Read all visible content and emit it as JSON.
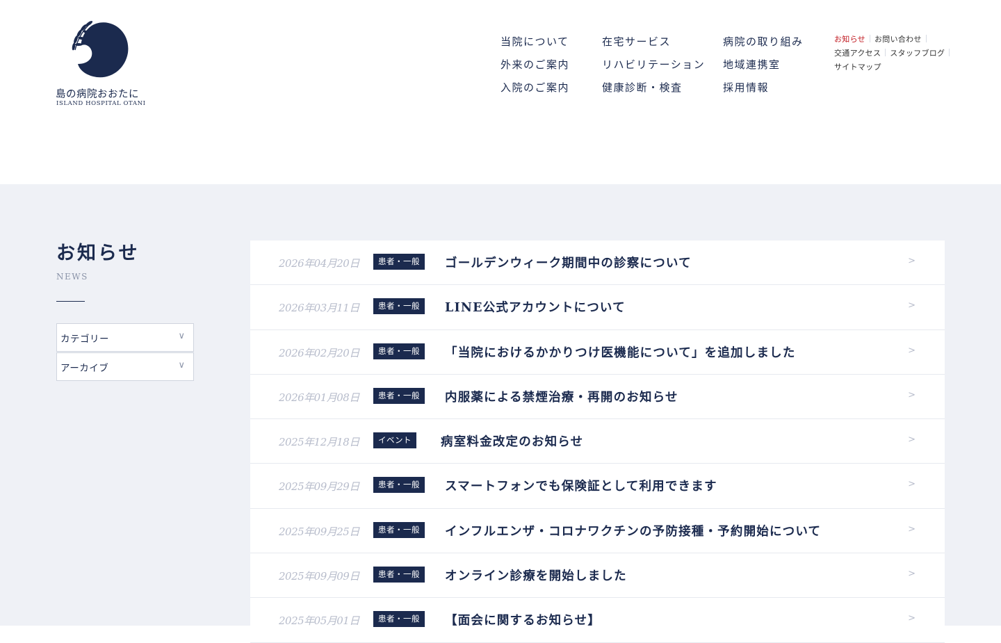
{
  "site": {
    "name_jp": "島の病院おおたに",
    "name_en": "ISLAND HOSPITAL OTANI"
  },
  "colors": {
    "navy": "#1b2a4e",
    "accent_red": "#c0171e",
    "page_bg": "#eff1f6"
  },
  "gnav": {
    "col1": [
      "当院について",
      "外来のご案内",
      "入院のご案内"
    ],
    "col2": [
      "在宅サービス",
      "リハビリテーション",
      "健康診断・検査"
    ],
    "col3": [
      "病院の取り組み",
      "地域連携室",
      "採用情報"
    ]
  },
  "subnav": {
    "news": "お知らせ",
    "contact": "お問い合わせ",
    "access": "交通アクセス",
    "blog": "スタッフブログ",
    "sitemap": "サイトマップ"
  },
  "side": {
    "title": "お知らせ",
    "subtitle": "NEWS",
    "category_label": "カテゴリー",
    "archive_label": "アーカイブ",
    "chevron": "∨"
  },
  "news": [
    {
      "date": "2026年04月20日",
      "tag": "患者・一般",
      "title": "ゴールデンウィーク期間中の診察について",
      "arrow": ">"
    },
    {
      "date": "2026年03月11日",
      "tag": "患者・一般",
      "title": "LINE公式アカウントについて",
      "arrow": ">"
    },
    {
      "date": "2026年02月20日",
      "tag": "患者・一般",
      "title": "「当院におけるかかりつけ医機能について」を追加しました",
      "arrow": ">"
    },
    {
      "date": "2026年01月08日",
      "tag": "患者・一般",
      "title": "内服薬による禁煙治療・再開のお知らせ",
      "arrow": ">"
    },
    {
      "date": "2025年12月18日",
      "tag": "イベント",
      "title": "病室料金改定のお知らせ",
      "arrow": ">"
    },
    {
      "date": "2025年09月29日",
      "tag": "患者・一般",
      "title": "スマートフォンでも保険証として利用できます",
      "arrow": ">"
    },
    {
      "date": "2025年09月25日",
      "tag": "患者・一般",
      "title": "インフルエンザ・コロナワクチンの予防接種・予約開始について",
      "arrow": ">"
    },
    {
      "date": "2025年09月09日",
      "tag": "患者・一般",
      "title": "オンライン診療を開始しました",
      "arrow": ">"
    },
    {
      "date": "2025年05月01日",
      "tag": "患者・一般",
      "title": "【面会に関するお知らせ】",
      "arrow": ">"
    }
  ]
}
